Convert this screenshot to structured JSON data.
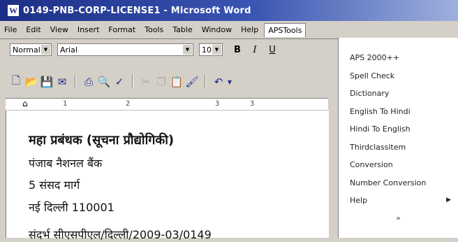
{
  "window": {
    "title": "0149-PNB-CORP-LICENSE1 - Microsoft Word"
  },
  "menubar": {
    "items": [
      "File",
      "Edit",
      "View",
      "Insert",
      "Format",
      "Tools",
      "Table",
      "Window",
      "Help",
      "APSTools"
    ]
  },
  "formatting": {
    "style": "Normal",
    "font": "Arial",
    "size": "10",
    "bold": "B",
    "italic": "I",
    "underline": "U"
  },
  "ruler": {
    "marks": [
      "1",
      "2",
      "3"
    ]
  },
  "document": {
    "lines": [
      "महा प्रबंधक (सूचना प्रौद्योगिकी)",
      "पंजाब नैशनल बैंक",
      "5 संसद मार्ग",
      "नई दिल्ली 110001",
      "संदर्भ  सीएसपीएल/दिल्ली/2009-03/0149"
    ]
  },
  "apstools_menu": {
    "items": [
      "APS 2000++",
      "Spell Check",
      "Dictionary",
      "English To Hindi",
      "Hindi To English",
      "Thirdclassitem",
      "Conversion",
      "Number Conversion",
      "Help"
    ],
    "more": "»"
  }
}
